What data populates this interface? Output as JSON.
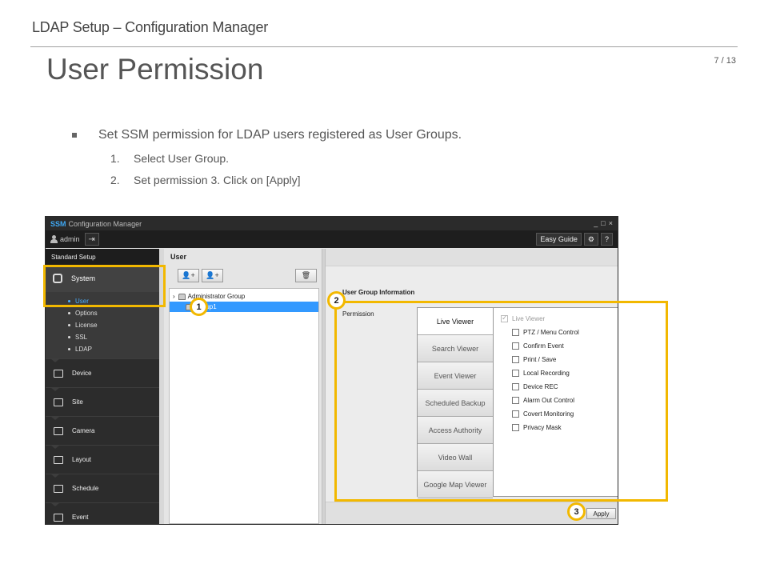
{
  "slide": {
    "header": "LDAP Setup – Configuration Manager",
    "title": "User Permission",
    "page": "7 / 13",
    "bullet": "Set SSM permission for LDAP users registered as User Groups.",
    "steps": [
      {
        "num": "1.",
        "text": "Select User Group."
      },
      {
        "num": "2.",
        "text": "Set permission 3. Click on [Apply]"
      }
    ]
  },
  "app": {
    "brand": "SSM",
    "title": "Configuration Manager",
    "window_controls": [
      "_",
      "□",
      "×"
    ],
    "user": "admin",
    "easy_guide": "Easy Guide",
    "settings_icon": "⚙",
    "help_icon": "?",
    "sidebar": {
      "header": "Standard Setup",
      "system": "System",
      "system_sub": [
        "User",
        "Options",
        "License",
        "SSL",
        "LDAP"
      ],
      "items": [
        "Device",
        "Site",
        "Camera",
        "Layout",
        "Schedule",
        "Event"
      ]
    },
    "user_panel": {
      "header": "User",
      "tree": [
        {
          "label": "Administrator Group"
        },
        {
          "label": "Group1"
        }
      ]
    },
    "group_info": {
      "title": "User Group Information",
      "permission_label": "Permission",
      "tabs": [
        "Live Viewer",
        "Search Viewer",
        "Event Viewer",
        "Scheduled Backup",
        "Access Authority",
        "Video Wall",
        "Google Map Viewer"
      ],
      "active_tab": "Live Viewer",
      "section": "Live Viewer",
      "options": [
        "PTZ / Menu Control",
        "Confirm Event",
        "Print / Save",
        "Local Recording",
        "Device REC",
        "Alarm Out Control",
        "Covert Monitoring",
        "Privacy Mask"
      ]
    },
    "apply": "Apply"
  },
  "callouts": [
    "1",
    "2",
    "3"
  ],
  "colors": {
    "highlight": "#f2b800",
    "selection": "#3399ff",
    "accent": "#4ab0ff"
  }
}
